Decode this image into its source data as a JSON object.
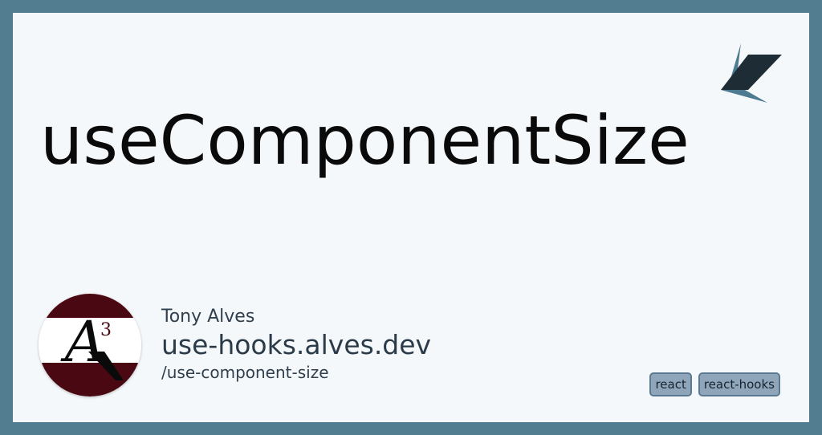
{
  "title": "useComponentSize",
  "author": "Tony Alves",
  "site": "use-hooks.alves.dev",
  "path": "/use-component-size",
  "avatar_monogram": "A",
  "avatar_superscript": "3",
  "tags": [
    "react",
    "react-hooks"
  ],
  "colors": {
    "frame": "#527c8f",
    "card": "#f5f8fb",
    "avatar_stripe": "#4a0912",
    "tag_bg": "#8fa6ba",
    "logo_dark": "#1e2c36",
    "logo_light": "#4d7a90"
  },
  "icons": {
    "brand_logo": "paper-plane-logo-icon",
    "avatar": "a3-monogram-avatar"
  }
}
